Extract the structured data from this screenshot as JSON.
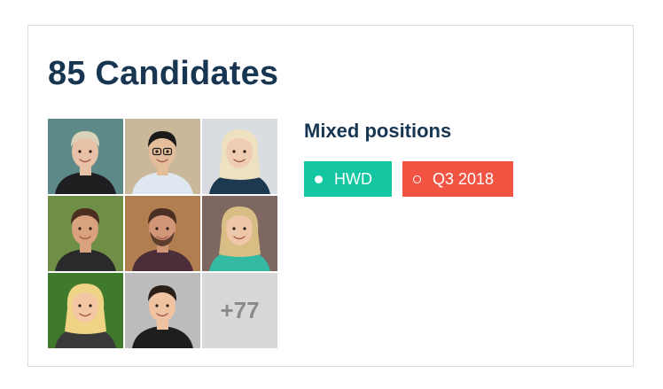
{
  "card": {
    "title": "85 Candidates",
    "position": "Mixed positions",
    "more_count": "+77",
    "avatars": [
      {
        "name": "candidate-avatar-1",
        "bg": "#5d8a88",
        "skin": "#e8c2a6",
        "hair": "#d9d2b8",
        "shirt": "#1f1f22"
      },
      {
        "name": "candidate-avatar-2",
        "bg": "#c9b89a",
        "skin": "#e4bd9b",
        "hair": "#1a1a1a",
        "shirt": "#dfe8f0"
      },
      {
        "name": "candidate-avatar-3",
        "bg": "#d9dde1",
        "skin": "#efcdb2",
        "hair": "#ede1bf",
        "shirt": "#1d3950"
      },
      {
        "name": "candidate-avatar-4",
        "bg": "#6f8f47",
        "skin": "#d8a27e",
        "hair": "#4b2e1f",
        "shirt": "#2a2a2a"
      },
      {
        "name": "candidate-avatar-5",
        "bg": "#b07e4f",
        "skin": "#d09677",
        "hair": "#4a2f22",
        "shirt": "#4b2e39"
      },
      {
        "name": "candidate-avatar-6",
        "bg": "#7e6760",
        "skin": "#eec7a9",
        "hair": "#d8bd85",
        "shirt": "#34b9a3"
      },
      {
        "name": "candidate-avatar-7",
        "bg": "#3f7a2c",
        "skin": "#f3c7a4",
        "hair": "#f0d486",
        "shirt": "#3a3a3a"
      },
      {
        "name": "candidate-avatar-8",
        "bg": "#bcbcbc",
        "skin": "#efc2a2",
        "hair": "#2b2018",
        "shirt": "#1e1e1e"
      }
    ]
  },
  "tags": [
    {
      "label": "HWD",
      "color": "#14c6a1",
      "dot": "filled"
    },
    {
      "label": "Q3 2018",
      "color": "#f25443",
      "dot": "hollow"
    }
  ]
}
